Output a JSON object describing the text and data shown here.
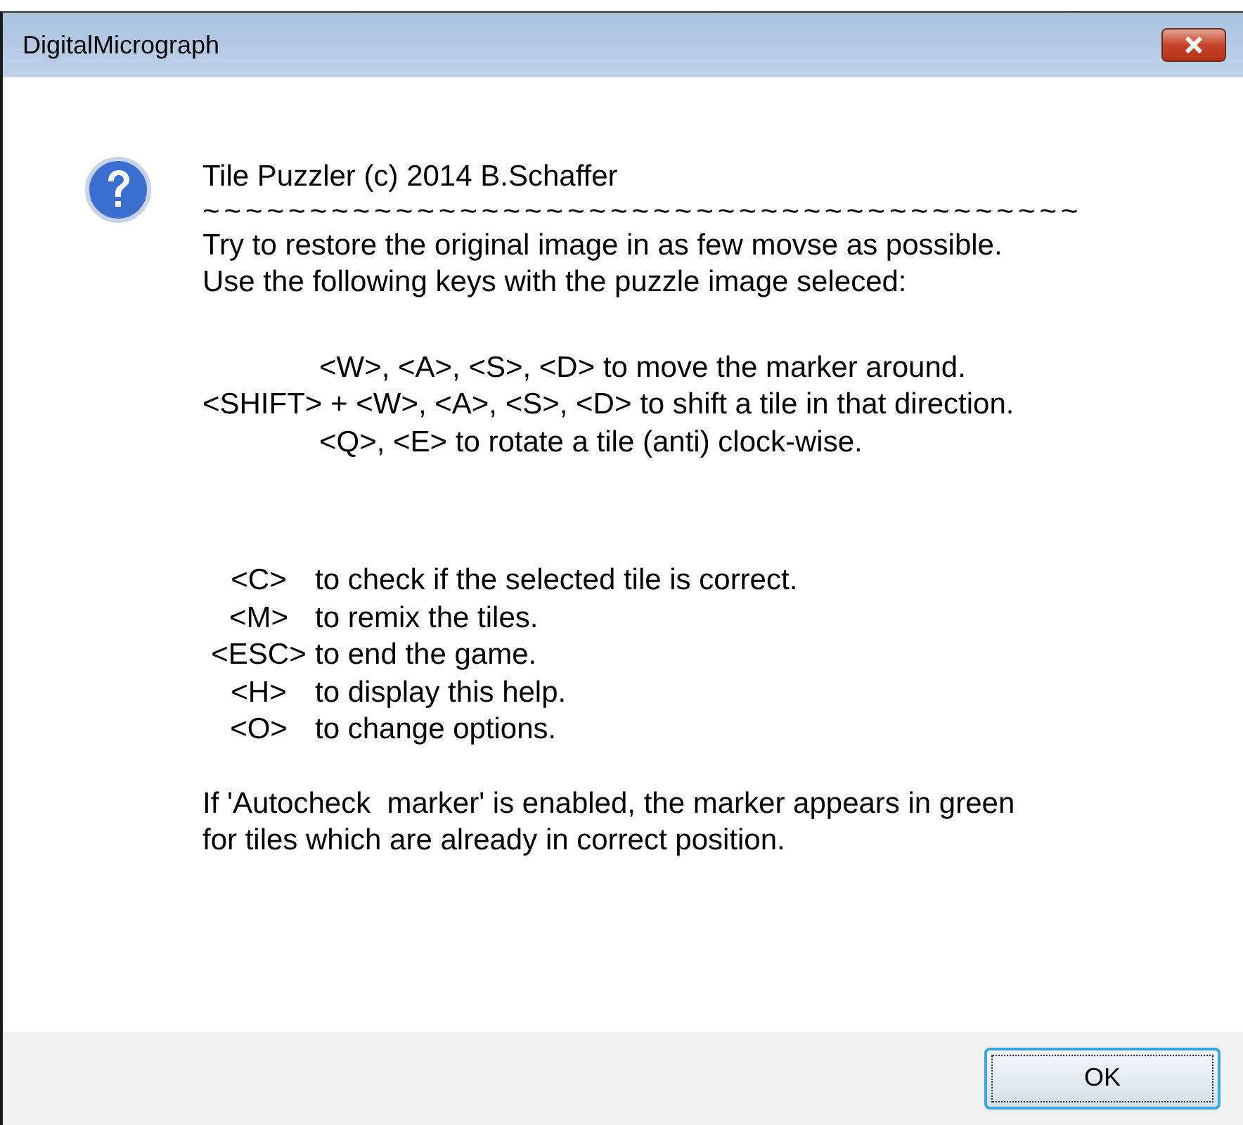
{
  "window": {
    "title": "DigitalMicrograph"
  },
  "message": {
    "heading": "Tile Puzzler (c) 2014 B.Schaffer",
    "separator": "~~~~~~~~~~~~~~~~~~~~~~~~~~~~~~~~~~~~~~~~~",
    "intro": [
      "Try to restore the original image in as few movse as possible.",
      "Use the following keys with the puzzle image seleced:"
    ],
    "moves": [
      {
        "text": "<W>, <A>, <S>, <D> to move the marker around.",
        "indented": true
      },
      {
        "text": "<SHIFT> + <W>, <A>, <S>, <D> to shift a tile in that direction.",
        "indented": false
      },
      {
        "text": "<Q>, <E> to rotate a tile (anti) clock-wise.",
        "indented": true
      }
    ],
    "commands": [
      {
        "key": "<C>",
        "action": "to check if the selected tile is correct."
      },
      {
        "key": "<M>",
        "action": "to remix the tiles."
      },
      {
        "key": "<ESC>",
        "action": "to end the game."
      },
      {
        "key": "<H>",
        "action": "to display this help."
      },
      {
        "key": "<O>",
        "action": "to change options."
      }
    ],
    "note": [
      "If 'Autocheck  marker' is enabled, the marker appears in green",
      "for tiles which are already in correct position."
    ]
  },
  "buttons": [
    {
      "label": "OK"
    }
  ]
}
